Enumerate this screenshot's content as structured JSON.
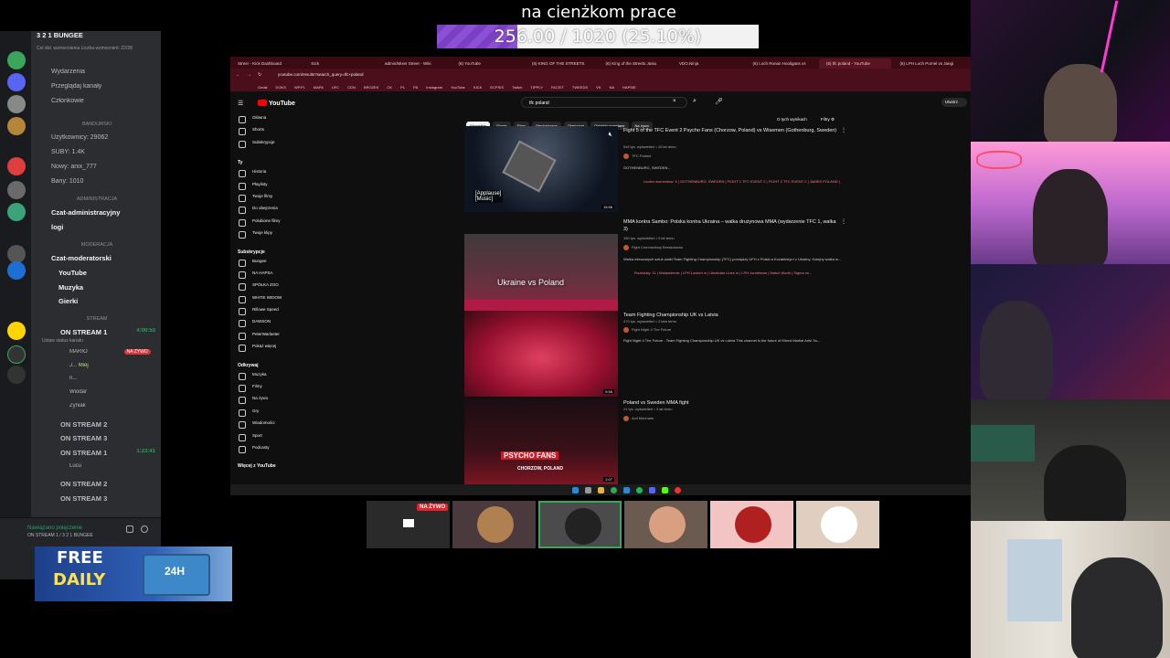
{
  "goal": {
    "title": "na cienżkom prace",
    "progress_text": "256.00 / 1020 (25.10%)",
    "fraction": 0.251
  },
  "discord": {
    "server_name": "3 2 1 BUNGEE",
    "goal_line": "Cel doł. wzmocnienia",
    "goal_value": "Liczba wzmocnień: 22/28",
    "menu": [
      "Wydarzenia",
      "Przeglądaj kanały",
      "Członkowie"
    ],
    "cat_bandurski": "BANDURSKI",
    "stats": [
      "Użytkownicy: 29062",
      "SUBY: 1.4K",
      "Nowy: anix_777",
      "Bany: 1010"
    ],
    "cat_admin": "ADMINISTRACJA",
    "admin_channels": [
      "Czat-administracyjny",
      "logi"
    ],
    "cat_mod": "MODERACJA",
    "mod_channels": [
      "Czat-moderatorski",
      "YouTube",
      "Muzyka",
      "Gierki"
    ],
    "cat_stream": "STREAM",
    "stream_active": "ON STREAM 1",
    "stream_timer": "4:00:53",
    "stream_status": "Ustaw status kanału",
    "members": [
      "MARIO",
      "J...",
      "n...",
      "Wiodar",
      "Zyniak"
    ],
    "live_badge": "NA ŻYWO",
    "member_tag": "Miej",
    "streams": [
      "ON STREAM 2",
      "ON STREAM 3",
      "ON STREAM 1",
      "ON STREAM 2",
      "ON STREAM 3"
    ],
    "stream1_timer": "1:23:41",
    "stream_member": "Lucu",
    "conn_status": "Nawiązano połączenie",
    "conn_channel": "ON STREAM 1 / 3 2 1 BUNGEE"
  },
  "promo": {
    "line1": "FREE",
    "line2": "DAILY",
    "box_label": "24H"
  },
  "browser": {
    "tabs": [
      "Streer - Kick Dashboard",
      "Kick",
      "admin/Mixer Streer - Wiki",
      "(6) YouTube",
      "(6) KING OF THE STREETS",
      "(6) King of the Streets Jasiu",
      "VDO.Ninja",
      "(6) Loch Ronan Hooligans vs",
      "(6) tfc poland - YouTube",
      "(6) LPH Loch Pornel vs Jangi"
    ],
    "url": "youtube.com/results?search_query=tfc+poland",
    "bookmarks": "Gmail DOKS WP.PL MAPA UFC CDN BROZEK CK PL FB Instagram YouTube KICK ECPSIS Twitch TIPPLY FACEIT TWEEDS VK NA HAPSIE",
    "yt_logo": "YouTube",
    "search_query": "tfc poland",
    "create_label": "Utwórz",
    "sidebar_top": [
      "Główna",
      "Shorts",
      "Subskrypcje"
    ],
    "you_head": "Ty",
    "you_items": [
      "Historia",
      "Playlisty",
      "Twoje filmy",
      "Do obejrzenia",
      "Polubione filmy",
      "Twoje klipy"
    ],
    "subs_head": "Subskrypcje",
    "subs_items": [
      "Bungee",
      "NA HAPSA",
      "SPÓŁKA ZOO",
      "WHITE WIDOW",
      "Rillowe Speed",
      "DAWSON",
      "PeterWarlaster",
      "Pokaż więcej"
    ],
    "explore_head": "Odkrywaj",
    "explore_items": [
      "Muzyka",
      "Filmy",
      "Na żywo",
      "Gry",
      "Wiadomości",
      "Sport",
      "Podcasty"
    ],
    "more_head": "Więcej z YouTube",
    "chips": [
      "Wszystkie",
      "Shorts",
      "Filmy",
      "Nieobejrzane",
      "Obejrzane",
      "Ostatnio przesłane",
      "Na żywo"
    ],
    "filters_info": "O tych wynikach",
    "filters": "Filtry",
    "results": [
      {
        "title": "Fight 5 of the TFC Event 2 Psycho Fans (Chorzow, Poland) vs Wisemen (Gothenburg, Sweden)",
        "meta": "5x5 tys. wyświetleń • 10 lat temu",
        "channel": "TFC Poland",
        "extra": "GOTHENBURG, SWEDEN...",
        "extra2": "Liczba momentów: 5 | GOTHENBURG, SWEDEN | FIGHT 1 TFC EVENT 2 | FIGHT 2 TFC EVENT 2 | JAMES POLAND |",
        "caption": "[Applause] [Music]",
        "duration": "15:56"
      },
      {
        "title": "MMA kontra Sambo: Polska kontra Ukraina – walka drużynowa MMA (wydarzenie TFC 1, walka 3)",
        "meta": "150 tys. wyświetleń • 9 lat temu",
        "channel": "Fight Commentary Breakdowns",
        "extra": "Walka mieszanych sztuk walki Team Fighting Championship (TFC) pomiędzy UFH z Polski a Kozakhstyn! z Ukrainy. Kolejny walka w...",
        "extra2": "Rozdziały: 11 | Wstawiennie | LPH Locked in | Ukrainian Lines in | LPH Jondelown | Match Worth | Sigma vs...",
        "caption": "Ukraine vs Poland",
        "duration": "10:28"
      },
      {
        "title": "Team Fighting Championship UK vs Latvia",
        "meta": "470 tys. wyświetleń • 2 lata temu",
        "channel": "Fight Night 4 The Future",
        "extra": "Fight Night 4 The Future - Team Fighting Championship UK vs Latvia This channel is the future of Mixed Martial Arts! Su...",
        "extra2": "",
        "caption": "",
        "duration": "6:56"
      },
      {
        "title": "Poland vs Sweden MMA fight",
        "meta": "21 tys. wyświetleń • 3 lat temu",
        "channel": "Anil Mechado",
        "extra": "",
        "extra2": "",
        "caption": "PSYCHO FANS",
        "caption2": "CHORZOW, POLAND",
        "duration": "2:07"
      }
    ]
  },
  "tiles": {
    "live_badge": "NA ŻYWO"
  },
  "colors": {
    "goal_fill": "#7b3fc4",
    "browser_frame": "#4a0f1a",
    "yt_red": "#ff0000",
    "discord_bg": "#2b2d31",
    "live_red": "#e62129"
  },
  "icons": [
    "search-icon",
    "mic-icon",
    "clear-icon",
    "filter-icon",
    "more-icon",
    "home-icon",
    "shorts-icon",
    "subs-icon",
    "hash-icon",
    "speaker-icon",
    "mic-off-icon"
  ]
}
